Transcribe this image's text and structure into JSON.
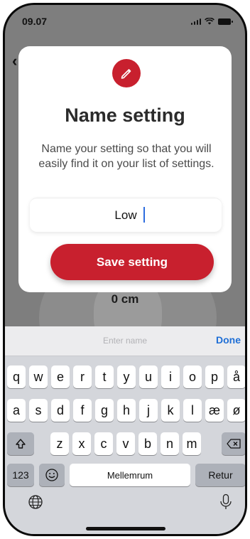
{
  "status": {
    "time": "09.07"
  },
  "background": {
    "distance_label": "0 cm"
  },
  "modal": {
    "icon": "pencil-icon",
    "title": "Name setting",
    "description": "Name your setting so that you will easily find it on your list of settings.",
    "input_value": "Low",
    "save_label": "Save setting"
  },
  "keyboard": {
    "placeholder": "Enter name",
    "done_label": "Done",
    "row1": [
      "q",
      "w",
      "e",
      "r",
      "t",
      "y",
      "u",
      "i",
      "o",
      "p",
      "å"
    ],
    "row2": [
      "a",
      "s",
      "d",
      "f",
      "g",
      "h",
      "j",
      "k",
      "l",
      "æ",
      "ø"
    ],
    "row3": [
      "z",
      "x",
      "c",
      "v",
      "b",
      "n",
      "m"
    ],
    "numbers_label": "123",
    "space_label": "Mellemrum",
    "return_label": "Retur"
  },
  "colors": {
    "accent": "#c8202e",
    "link": "#1f6fd6"
  }
}
